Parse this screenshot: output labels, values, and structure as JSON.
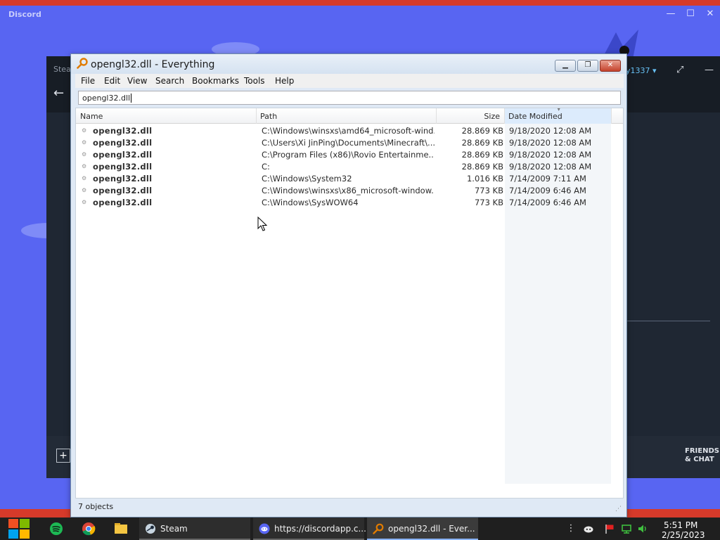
{
  "discord": {
    "title": "Discord",
    "minimize": "—",
    "maximize": "☐",
    "close": "✕"
  },
  "steam": {
    "label": "Stea",
    "back": "←",
    "user": "y1337 ▾",
    "friends_line1": "FRIENDS",
    "friends_line2": "& CHAT",
    "add": "+"
  },
  "everything": {
    "title": "opengl32.dll - Everything",
    "menu": [
      "File",
      "Edit",
      "View",
      "Search",
      "Bookmarks",
      "Tools",
      "Help"
    ],
    "search_value": "opengl32.dll",
    "columns": {
      "name": "Name",
      "path": "Path",
      "size": "Size",
      "date": "Date Modified"
    },
    "rows": [
      {
        "name": "opengl32.dll",
        "path": "C:\\Windows\\winsxs\\amd64_microsoft-wind...",
        "size": "28.869 KB",
        "date": "9/18/2020 12:08 AM"
      },
      {
        "name": "opengl32.dll",
        "path": "C:\\Users\\Xi JinPing\\Documents\\Minecraft\\...",
        "size": "28.869 KB",
        "date": "9/18/2020 12:08 AM"
      },
      {
        "name": "opengl32.dll",
        "path": "C:\\Program Files (x86)\\Rovio Entertainme...",
        "size": "28.869 KB",
        "date": "9/18/2020 12:08 AM"
      },
      {
        "name": "opengl32.dll",
        "path": "C:",
        "size": "28.869 KB",
        "date": "9/18/2020 12:08 AM"
      },
      {
        "name": "opengl32.dll",
        "path": "C:\\Windows\\System32",
        "size": "1.016 KB",
        "date": "7/14/2009 7:11 AM"
      },
      {
        "name": "opengl32.dll",
        "path": "C:\\Windows\\winsxs\\x86_microsoft-window...",
        "size": "773 KB",
        "date": "7/14/2009 6:46 AM"
      },
      {
        "name": "opengl32.dll",
        "path": "C:\\Windows\\SysWOW64",
        "size": "773 KB",
        "date": "7/14/2009 6:46 AM"
      }
    ],
    "status": "7 objects"
  },
  "taskbar": {
    "tasks": [
      {
        "label": "Steam"
      },
      {
        "label": "https://discordapp.c..."
      },
      {
        "label": "opengl32.dll - Ever..."
      }
    ],
    "time": "5:51 PM",
    "date": "2/25/2023"
  },
  "colors": {
    "discord_blurple": "#5865f2",
    "steam_dark": "#1f2733",
    "taskbar": "#1f1f1f",
    "accent_blue": "#8ab4f8"
  }
}
